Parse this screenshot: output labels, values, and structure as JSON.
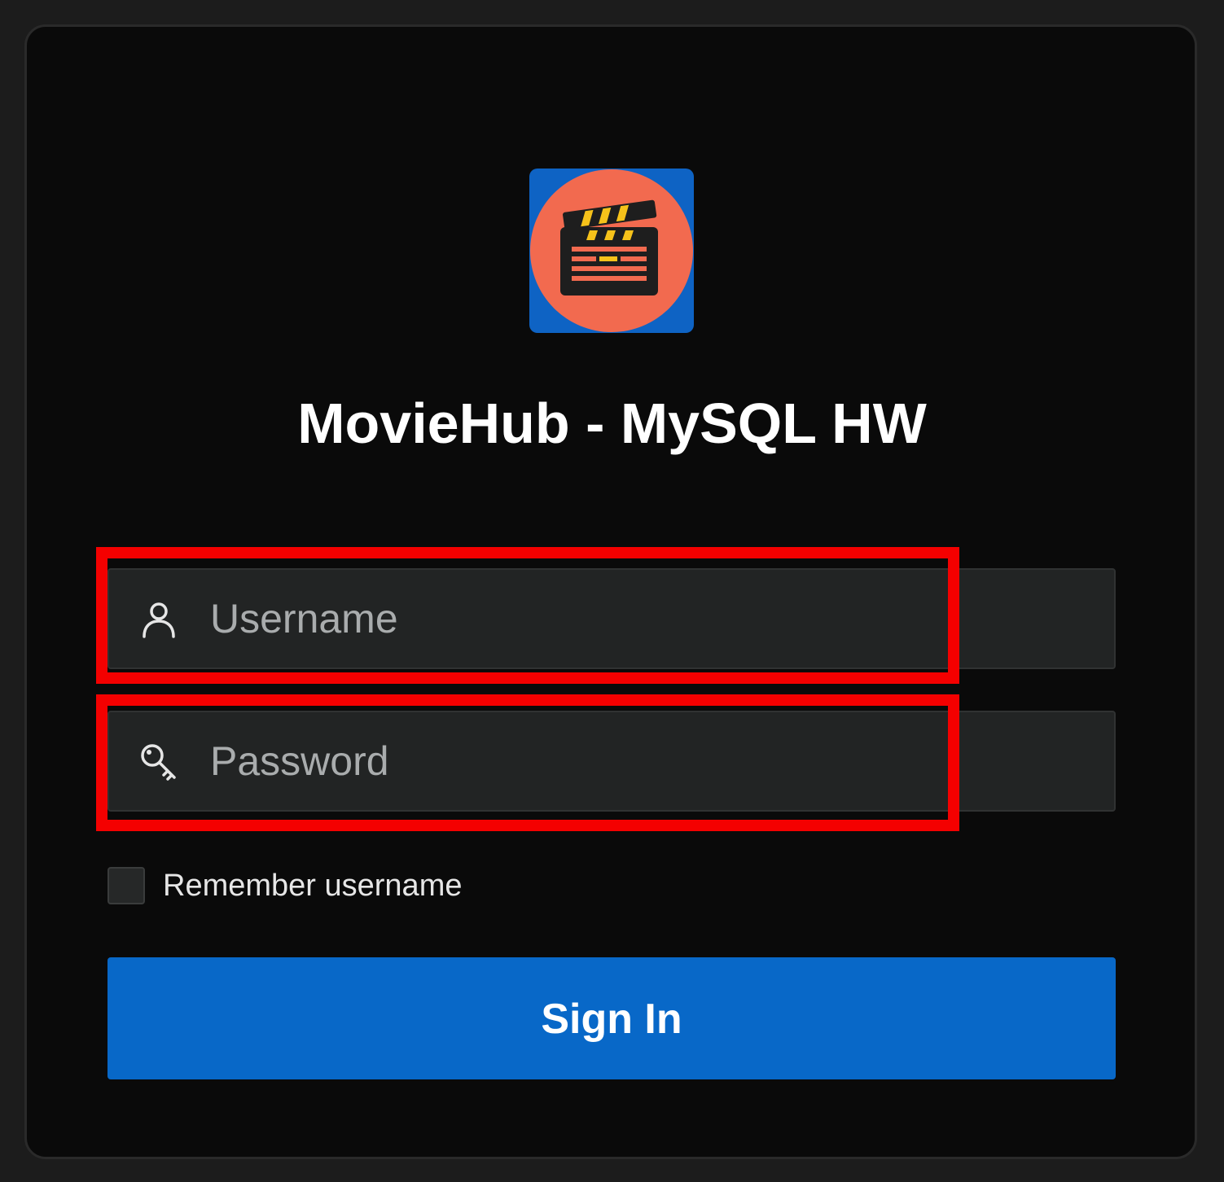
{
  "app": {
    "title": "MovieHub - MySQL HW",
    "logo_icon": "clapperboard-icon",
    "logo_bg_color": "#0e63c4",
    "logo_circle_color": "#f26a4f"
  },
  "login_form": {
    "username": {
      "placeholder": "Username",
      "value": "",
      "icon": "user-icon"
    },
    "password": {
      "placeholder": "Password",
      "value": "",
      "icon": "key-icon"
    },
    "remember": {
      "label": "Remember username",
      "checked": false
    },
    "submit_label": "Sign In",
    "submit_color": "#0868c8"
  },
  "annotation": {
    "highlight_color": "#f40000"
  }
}
